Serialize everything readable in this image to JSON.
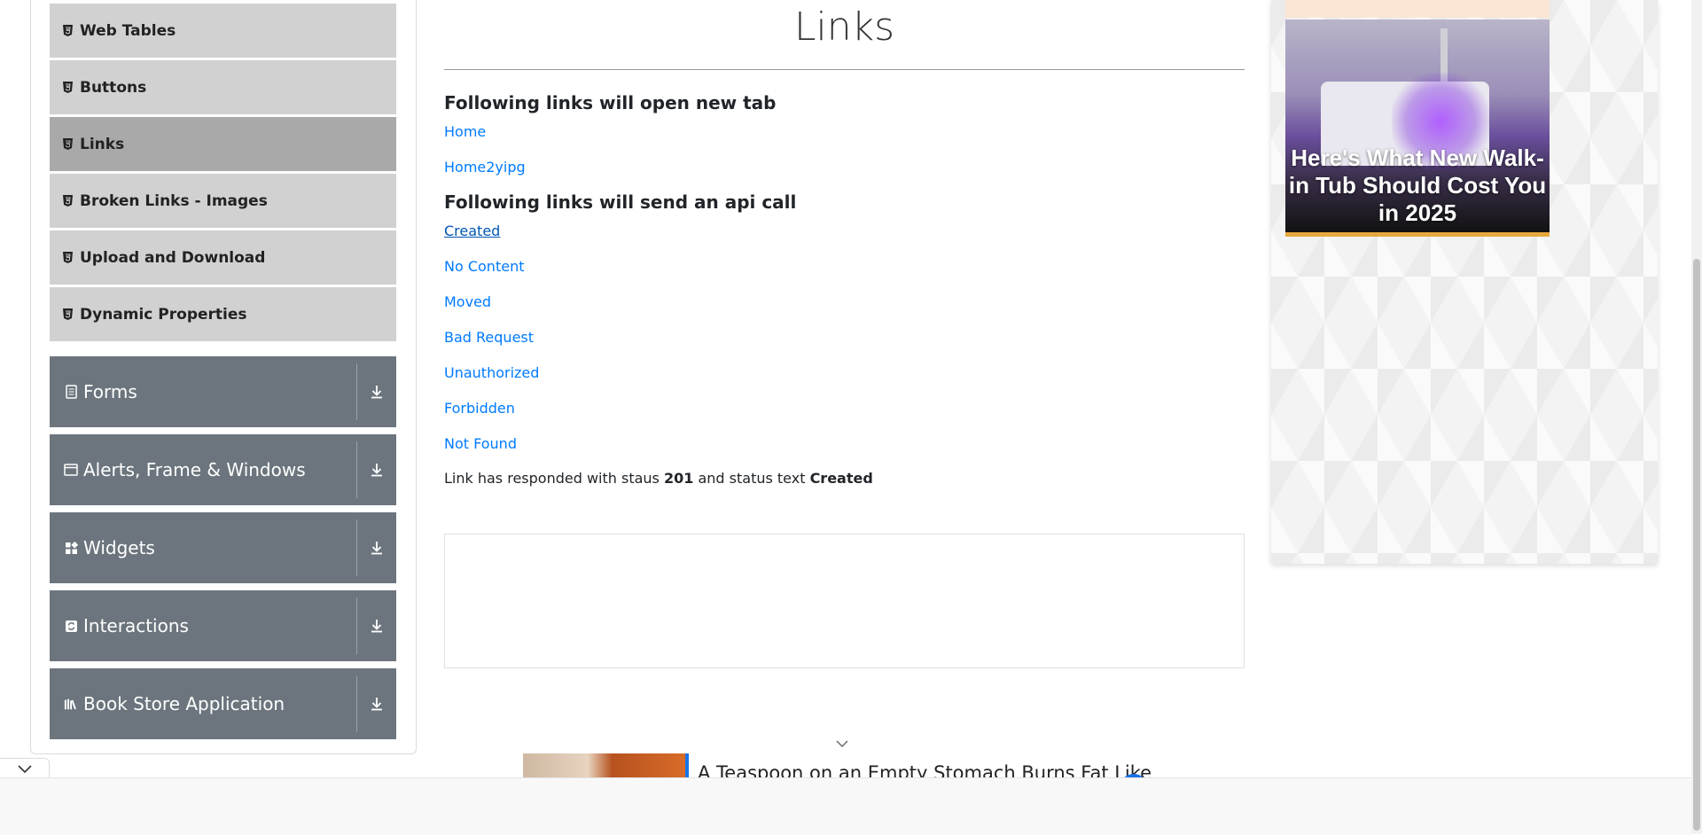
{
  "sidebar": {
    "element_items": [
      {
        "label": "Web Tables",
        "active": false
      },
      {
        "label": "Buttons",
        "active": false
      },
      {
        "label": "Links",
        "active": true
      },
      {
        "label": "Broken Links - Images",
        "active": false
      },
      {
        "label": "Upload and Download",
        "active": false
      },
      {
        "label": "Dynamic Properties",
        "active": false
      }
    ],
    "groups": [
      {
        "label": "Forms",
        "icon": "form-icon"
      },
      {
        "label": "Alerts, Frame & Windows",
        "icon": "window-icon"
      },
      {
        "label": "Widgets",
        "icon": "widgets-icon"
      },
      {
        "label": "Interactions",
        "icon": "interactions-icon"
      },
      {
        "label": "Book Store Application",
        "icon": "books-icon"
      }
    ]
  },
  "main": {
    "title": "Links",
    "new_tab_heading": "Following links will open new tab",
    "new_tab_links": [
      "Home",
      "Home2yipg"
    ],
    "api_heading": "Following links will send an api call",
    "api_links": [
      "Created",
      "No Content",
      "Moved",
      "Bad Request",
      "Unauthorized",
      "Forbidden",
      "Not Found"
    ],
    "response": {
      "prefix": "Link has responded with staus ",
      "status_code": "201",
      "middle": " and status text ",
      "status_text": "Created"
    }
  },
  "side_ad": {
    "headline": "Here's What New Walk-in Tub Should Cost You in 2025"
  },
  "bottom_ad": {
    "text": "A Teaspoon on an Empty Stomach Burns Fat Like"
  },
  "colors": {
    "link": "#007bff",
    "menu_item_bg": "#d1d1d1",
    "menu_item_active_bg": "#a9a9a9",
    "group_header_bg": "#6c757d"
  }
}
